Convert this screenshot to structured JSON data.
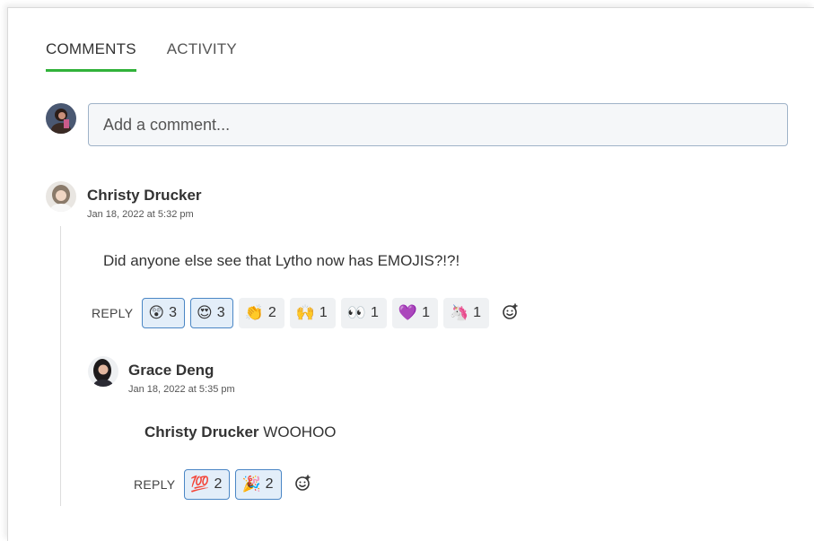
{
  "tabs": [
    {
      "label": "COMMENTS",
      "active": true
    },
    {
      "label": "ACTIVITY",
      "active": false
    }
  ],
  "composer": {
    "placeholder": "Add a comment..."
  },
  "comments": [
    {
      "author": "Christy Drucker",
      "timestamp": "Jan 18, 2022 at 5:32 pm",
      "body": "Did anyone else see that Lytho now has EMOJIS?!?!",
      "reply_label": "REPLY",
      "reactions": [
        {
          "emoji": "😲",
          "count": "3",
          "selected": true
        },
        {
          "emoji": "😍",
          "count": "3",
          "selected": true
        },
        {
          "emoji": "👏",
          "count": "2",
          "selected": false
        },
        {
          "emoji": "🙌",
          "count": "1",
          "selected": false
        },
        {
          "emoji": "👀",
          "count": "1",
          "selected": false
        },
        {
          "emoji": "💜",
          "count": "1",
          "selected": false
        },
        {
          "emoji": "🦄",
          "count": "1",
          "selected": false
        }
      ]
    },
    {
      "author": "Grace Deng",
      "timestamp": "Jan 18, 2022 at 5:35 pm",
      "mention": "Christy Drucker",
      "body": "WOOHOO",
      "reply_label": "REPLY",
      "reactions": [
        {
          "emoji": "💯",
          "count": "2",
          "selected": true
        },
        {
          "emoji": "🎉",
          "count": "2",
          "selected": true
        }
      ]
    }
  ],
  "colors": {
    "accent": "#31b23a",
    "selected_border": "#4a86c5"
  }
}
